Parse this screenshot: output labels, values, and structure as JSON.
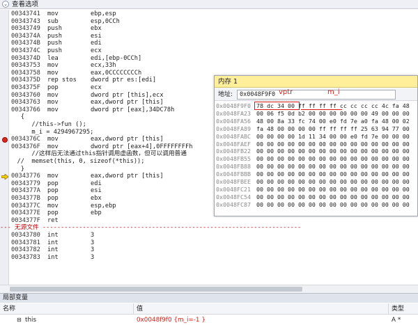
{
  "topbar": {
    "title": "查看选项"
  },
  "disasm": {
    "lines": [
      {
        "addr": "00343741",
        "mnem": "mov",
        "ops": "ebp,esp"
      },
      {
        "addr": "00343743",
        "mnem": "sub",
        "ops": "esp,0CCh"
      },
      {
        "addr": "00343749",
        "mnem": "push",
        "ops": "ebx"
      },
      {
        "addr": "0034374A",
        "mnem": "push",
        "ops": "esi"
      },
      {
        "addr": "0034374B",
        "mnem": "push",
        "ops": "edi"
      },
      {
        "addr": "0034374C",
        "mnem": "push",
        "ops": "ecx"
      },
      {
        "addr": "0034374D",
        "mnem": "lea",
        "ops": "edi,[ebp-0CCh]"
      },
      {
        "addr": "00343753",
        "mnem": "mov",
        "ops": "ecx,33h"
      },
      {
        "addr": "00343758",
        "mnem": "mov",
        "ops": "eax,0CCCCCCCCh"
      },
      {
        "addr": "0034375D",
        "mnem": "rep stos",
        "ops": "dword ptr es:[edi]"
      },
      {
        "addr": "0034375F",
        "mnem": "pop",
        "ops": "ecx"
      },
      {
        "addr": "00343760",
        "mnem": "mov",
        "ops": "dword ptr [this],ecx"
      },
      {
        "addr": "00343763",
        "mnem": "mov",
        "ops": "eax,dword ptr [this]"
      },
      {
        "addr": "00343766",
        "mnem": "mov",
        "ops": "dword ptr [eax],34DC78h"
      },
      {
        "src": "   {"
      },
      {
        "src": "      //this->fun ();"
      },
      {
        "src": "      m_i = 4294967295;"
      },
      {
        "addr": "0034376C",
        "mnem": "mov",
        "ops": "eax,dword ptr [this]"
      },
      {
        "addr": "0034376F",
        "mnem": "mov",
        "ops": "dword ptr [eax+4],0FFFFFFFFh"
      },
      {
        "src": "      //这样后无法通过this指针调用虚函数，但可以调用普通"
      },
      {
        "src": "  //  memset(this, 0, sizeof(*this));"
      },
      {
        "src": "   }"
      },
      {
        "addr": "00343776",
        "mnem": "mov",
        "ops": "eax,dword ptr [this]"
      },
      {
        "addr": "00343779",
        "mnem": "pop",
        "ops": "edi"
      },
      {
        "addr": "0034377A",
        "mnem": "pop",
        "ops": "esi"
      },
      {
        "addr": "0034377B",
        "mnem": "pop",
        "ops": "ebx"
      },
      {
        "addr": "0034377C",
        "mnem": "mov",
        "ops": "esp,ebp"
      },
      {
        "addr": "0034377E",
        "mnem": "pop",
        "ops": "ebp"
      },
      {
        "addr": "0034377F",
        "mnem": "ret",
        "ops": ""
      },
      {
        "sep": "--- 无源文件 -----------------------------------------------------------------------"
      },
      {
        "addr": "00343780",
        "mnem": "int",
        "ops": "3"
      },
      {
        "addr": "00343781",
        "mnem": "int",
        "ops": "3"
      },
      {
        "addr": "00343782",
        "mnem": "int",
        "ops": "3"
      },
      {
        "addr": "00343783",
        "mnem": "int",
        "ops": "3"
      }
    ]
  },
  "memory": {
    "title": "内存 1",
    "address_label": "地址:",
    "address_value": "0x0048F9F0",
    "annotation_vptr": "vptr",
    "annotation_mi": "m_i",
    "rows": [
      {
        "addr": "0x0048F9F0",
        "bytes": "78 dc 34 00 ff ff ff ff cc cc cc cc 4c fa 48"
      },
      {
        "addr": "0x0048FA23",
        "bytes": "00 06 f5 0d b2 00 00 00 00 00 00 49 00 00 00"
      },
      {
        "addr": "0x0048FA56",
        "bytes": "48 00 8a 33 fc 74 00 e0 fd 7e a0 fa 48 00 02"
      },
      {
        "addr": "0x0048FA89",
        "bytes": "fa 48 00 00 00 00 ff ff ff ff 25 63 94 77 00"
      },
      {
        "addr": "0x0048FABC",
        "bytes": "00 00 00 00 1d 11 34 00 00 e0 fd 7e 00 00 00"
      },
      {
        "addr": "0x0048FAEF",
        "bytes": "00 00 00 00 00 00 00 00 00 00 00 00 00 00 00"
      },
      {
        "addr": "0x0048FB22",
        "bytes": "00 00 00 00 00 00 00 00 00 00 00 00 00 00 00"
      },
      {
        "addr": "0x0048FB55",
        "bytes": "00 00 00 00 00 00 00 00 00 00 00 00 00 00 00"
      },
      {
        "addr": "0x0048FB88",
        "bytes": "00 00 00 00 00 00 00 00 00 00 00 00 00 00 00"
      },
      {
        "addr": "0x0048FBBB",
        "bytes": "00 00 00 00 00 00 00 00 00 00 00 00 00 00 00"
      },
      {
        "addr": "0x0048FBEE",
        "bytes": "00 00 00 00 00 00 00 00 00 00 00 00 00 00 00"
      },
      {
        "addr": "0x0048FC21",
        "bytes": "00 00 00 00 00 00 00 00 00 00 00 00 00 00 00"
      },
      {
        "addr": "0x0048FC54",
        "bytes": "00 00 00 00 00 00 00 00 00 00 00 00 00 00 00"
      },
      {
        "addr": "0x0048FC87",
        "bytes": "00 00 00 00 00 00 00 00 00 00 00 00 00 00 00"
      }
    ]
  },
  "locals": {
    "title": "局部变量",
    "col_name": "名称",
    "col_value": "值",
    "col_type": "类型",
    "row": {
      "expand": "⊟",
      "name": "this",
      "value": "0x0048f9f0 {m_i=-1 }",
      "type": "A *"
    }
  }
}
